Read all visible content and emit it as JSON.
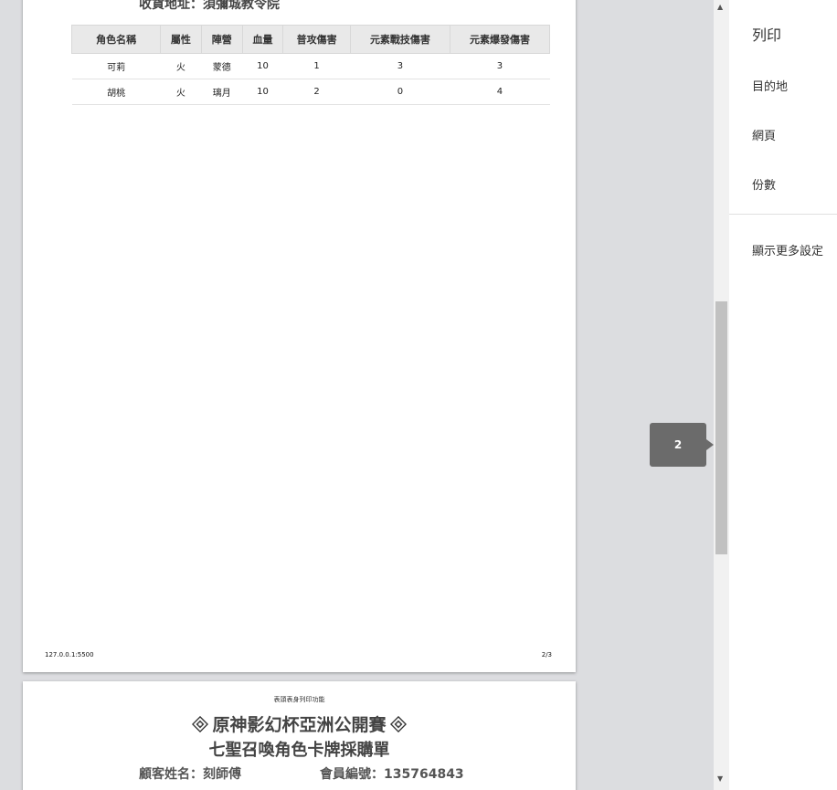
{
  "preview": {
    "page1": {
      "address": "收貨地址：須彌城教令院",
      "table": {
        "headers": [
          "角色名稱",
          "屬性",
          "陣營",
          "血量",
          "普攻傷害",
          "元素戰技傷害",
          "元素爆發傷害"
        ],
        "rows": [
          [
            "可莉",
            "火",
            "蒙德",
            "10",
            "1",
            "3",
            "3"
          ],
          [
            "胡桃",
            "火",
            "璃月",
            "10",
            "2",
            "0",
            "4"
          ]
        ]
      },
      "footer_url": "127.0.0.1:5500",
      "footer_page": "2/3"
    },
    "page2": {
      "header_note": "表頭表身列印功能",
      "title": "原神影幻杯亞洲公開賽",
      "subtitle": "七聖召喚角色卡牌採購單",
      "customer": "顧客姓名：刻師傅",
      "member": "會員編號：135764843"
    },
    "page_indicator": "2"
  },
  "settings": {
    "title": "列印",
    "destination": "目的地",
    "pages": "網頁",
    "copies": "份數",
    "more_settings": "顯示更多設定"
  }
}
